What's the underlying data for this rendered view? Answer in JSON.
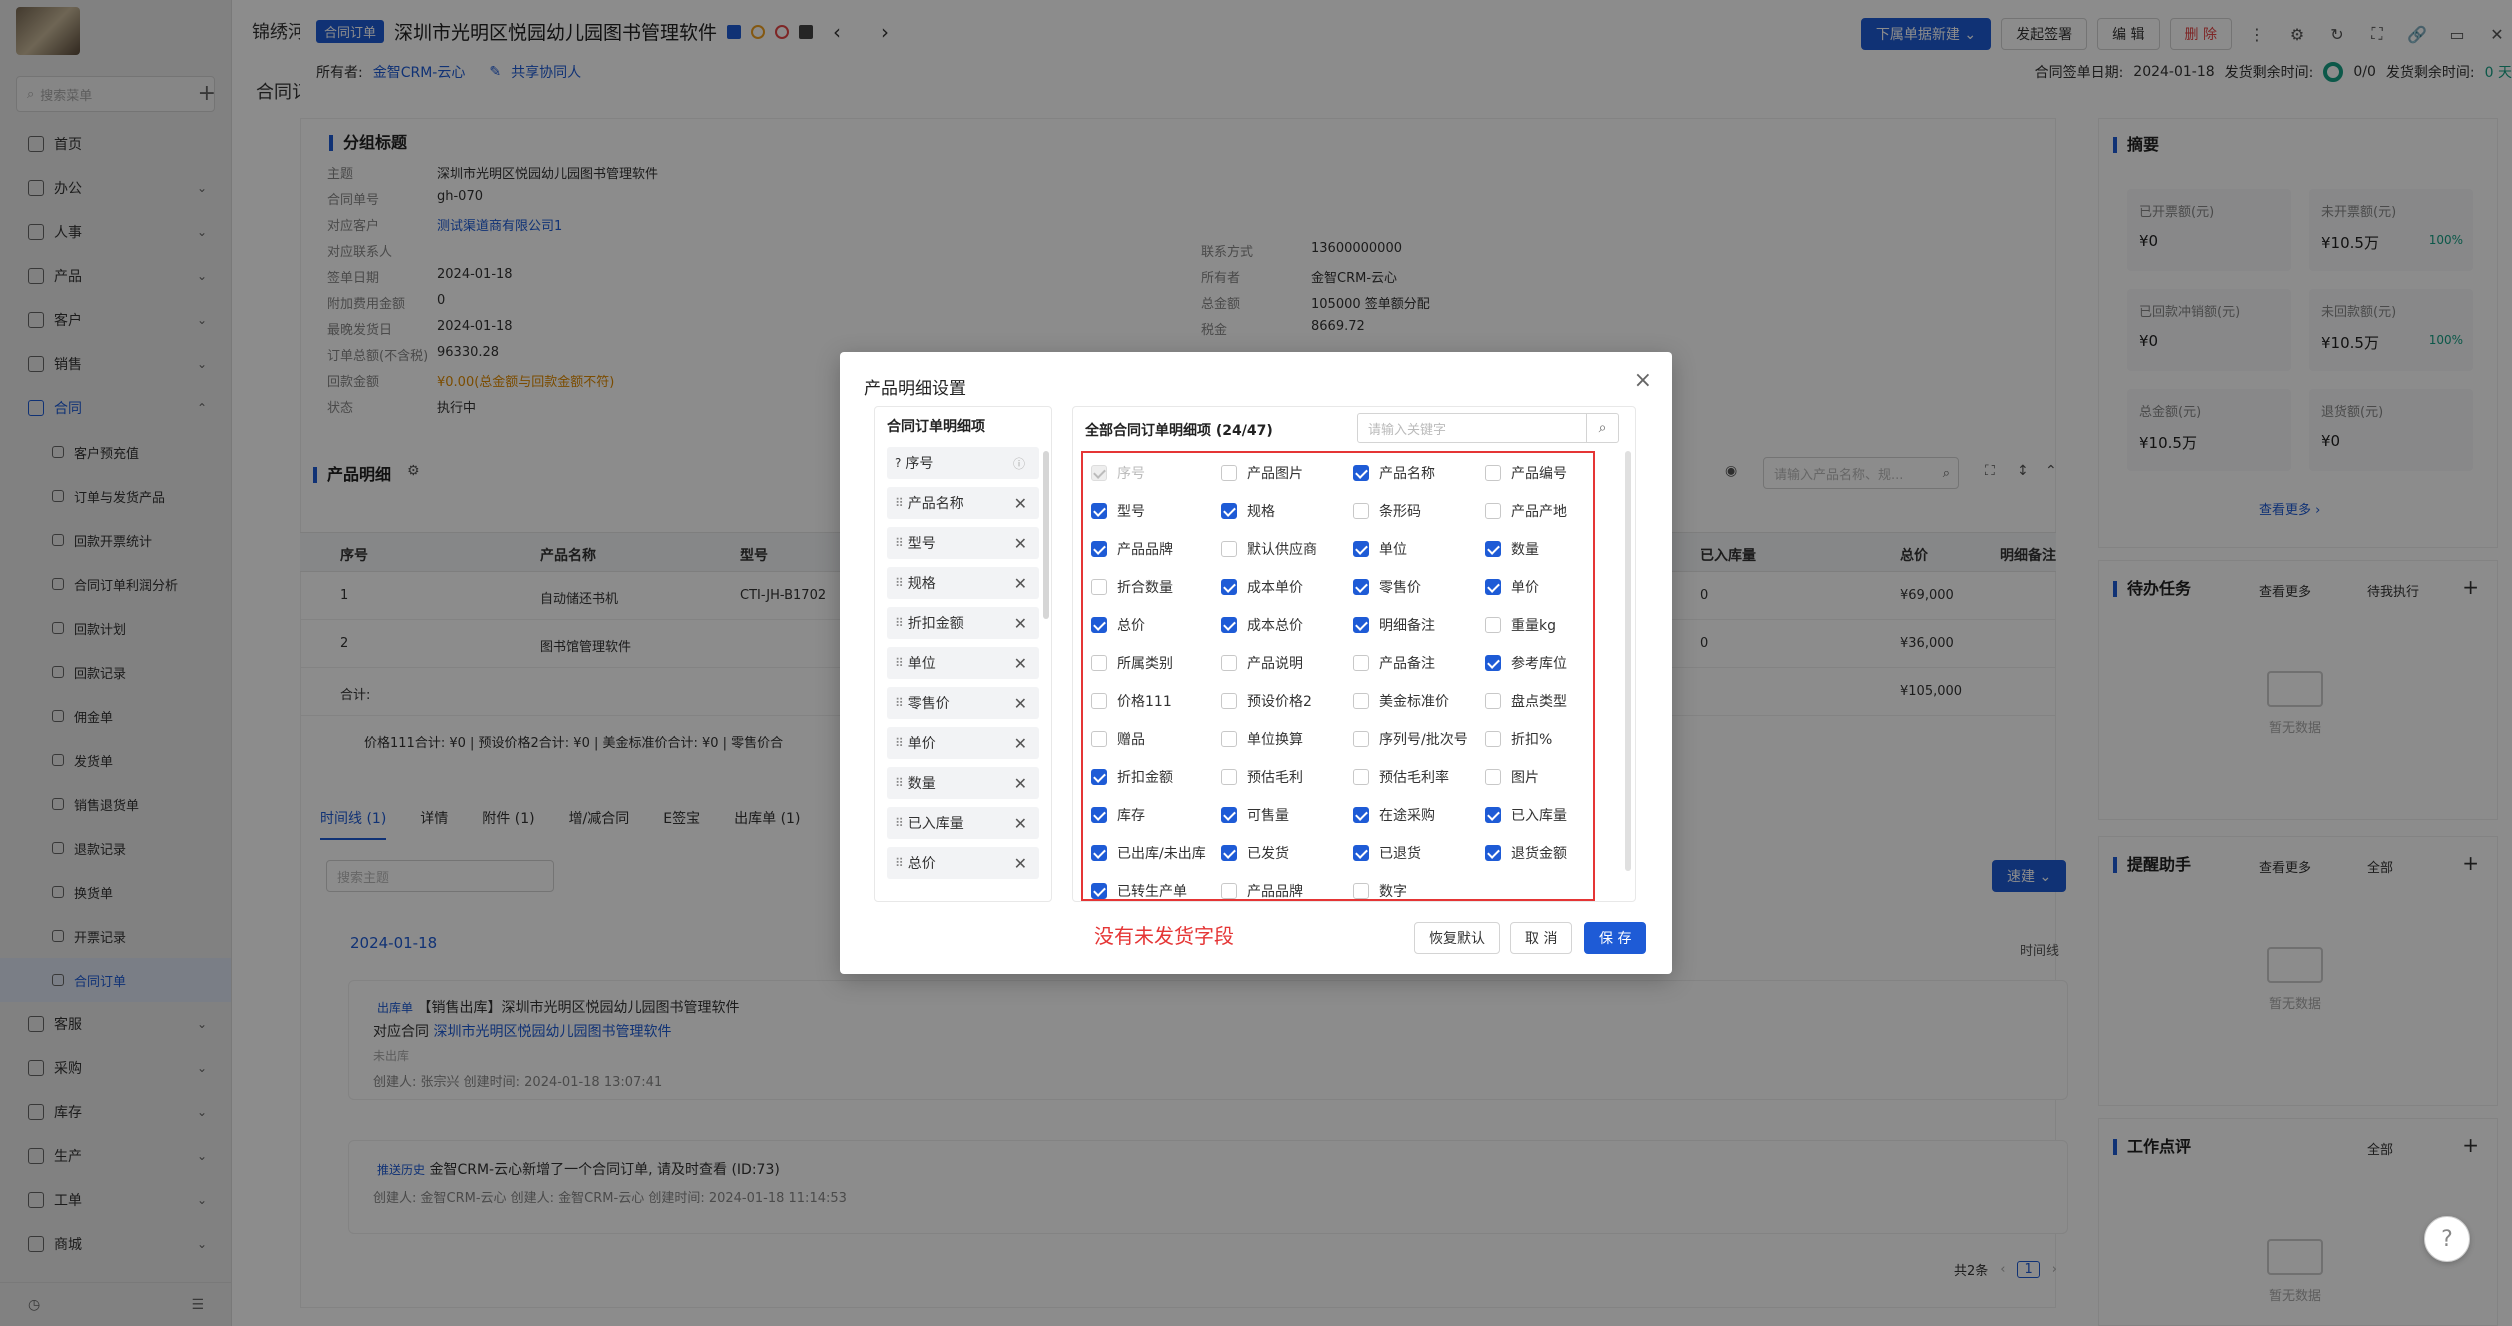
{
  "sidebar": {
    "search_placeholder": "搜索菜单",
    "items": [
      {
        "label": "首页",
        "arrow": ""
      },
      {
        "label": "办公",
        "arrow": "⌄"
      },
      {
        "label": "人事",
        "arrow": "⌄"
      },
      {
        "label": "产品",
        "arrow": "⌄"
      },
      {
        "label": "客户",
        "arrow": "⌄"
      },
      {
        "label": "销售",
        "arrow": "⌄"
      },
      {
        "label": "合同",
        "arrow": "⌃"
      }
    ],
    "sub_items": [
      "客户预充值",
      "订单与发货产品",
      "回款开票统计",
      "合同订单利润分析",
      "回款计划",
      "回款记录",
      "佣金单",
      "发货单",
      "销售退货单",
      "退款记录",
      "换货单",
      "开票记录",
      "合同订单"
    ],
    "bottom_items": [
      {
        "label": "客服",
        "arrow": "⌄"
      },
      {
        "label": "采购",
        "arrow": "⌄"
      },
      {
        "label": "库存",
        "arrow": "⌄"
      },
      {
        "label": "生产",
        "arrow": "⌄"
      },
      {
        "label": "工单",
        "arrow": "⌄"
      },
      {
        "label": "商城",
        "arrow": "⌄"
      }
    ]
  },
  "topbar": {
    "tab1": "锦绣河",
    "tab2": "合同订"
  },
  "header": {
    "badge": "合同订单",
    "title": "深圳市光明区悦园幼儿园图书管理软件",
    "owner_label": "所有者:",
    "owner_value": "金智CRM-云心",
    "collab": "共享协同人",
    "btn_new": "下属单据新建 ⌄",
    "btn_sign": "发起签署",
    "btn_edit": "编 辑",
    "btn_delete": "删 除",
    "sign_date_label": "合同签单日期:",
    "sign_date": "2024-01-18",
    "remain_label": "发货剩余时间:",
    "remain_count": "0/0",
    "remain_label2": "发货剩余时间:",
    "remain_days": "0 天"
  },
  "detail": {
    "section_title": "分组标题",
    "left": [
      {
        "k": "主题",
        "v": "深圳市光明区悦园幼儿园图书管理软件"
      },
      {
        "k": "合同单号",
        "v": "gh-070"
      },
      {
        "k": "对应客户",
        "v": "测试渠道商有限公司1"
      },
      {
        "k": "对应联系人",
        "v": ""
      },
      {
        "k": "签单日期",
        "v": "2024-01-18"
      },
      {
        "k": "附加费用金额",
        "v": "0"
      },
      {
        "k": "最晚发货日",
        "v": "2024-01-18"
      },
      {
        "k": "订单总额(不含税)",
        "v": "96330.28"
      },
      {
        "k": "回款金额",
        "v": "¥0.00(总金额与回款金额不符)"
      },
      {
        "k": "状态",
        "v": "执行中"
      }
    ],
    "right": [
      {
        "k": "联系方式",
        "v": "13600000000"
      },
      {
        "k": "所有者",
        "v": "金智CRM-云心"
      },
      {
        "k": "总金额",
        "v": "105000  签单额分配"
      },
      {
        "k": "税金",
        "v": "8669.72"
      }
    ],
    "product_title": "产品明细",
    "product_search": "请输入产品名称、规...",
    "table_headers": [
      "序号",
      "产品名称",
      "型号",
      "已入库量",
      "总价",
      "明细备注"
    ],
    "rows": [
      {
        "no": "1",
        "name": "自动储还书机",
        "model": "CTI-JH-B1702",
        "stock": "0",
        "total": "¥69,000"
      },
      {
        "no": "2",
        "name": "图书馆管理软件",
        "model": "",
        "stock": "0",
        "total": "¥36,000"
      }
    ],
    "sum_label": "合计:",
    "sum_total": "¥105,000",
    "footer_sum": "价格111合计: ¥0 | 预设价格2合计: ¥0 | 美金标准价合计: ¥0 | 零售价合",
    "tl_tabs": [
      "时间线 (1)",
      "详情",
      "附件 (1)",
      "增/减合同",
      "E签宝",
      "出库单 (1)"
    ],
    "tl_search": "搜索主题",
    "quick_new": "速建 ⌄",
    "date": "2024-01-18",
    "timeline_label": "时间线",
    "card1_tag": "出库单",
    "card1_title": "【销售出库】深圳市光明区悦园幼儿园图书管理软件",
    "card1_contract_label": "对应合同",
    "card1_contract": "深圳市光明区悦园幼儿园图书管理软件",
    "card1_status": "未出库",
    "card1_meta": "创建人: 张宗兴    创建时间: 2024-01-18 13:07:41",
    "card2_tag": "推送历史",
    "card2_title": "金智CRM-云心新增了一个合同订单, 请及时查看 (ID:73)",
    "card2_meta": "创建人: 金智CRM-云心    创建人: 金智CRM-云心    创建时间: 2024-01-18 11:14:53",
    "pager_total": "共2条",
    "pager_page": "1"
  },
  "summary": {
    "title": "摘要",
    "stats": [
      {
        "label": "已开票额(元)",
        "value": "¥0",
        "pct": ""
      },
      {
        "label": "未开票额(元)",
        "value": "¥10.5万",
        "pct": "100%"
      },
      {
        "label": "已回款冲销额(元)",
        "value": "¥0",
        "pct": ""
      },
      {
        "label": "未回款额(元)",
        "value": "¥10.5万",
        "pct": "100%"
      },
      {
        "label": "总金额(元)",
        "value": "¥10.5万",
        "pct": ""
      },
      {
        "label": "退货额(元)",
        "value": "¥0",
        "pct": ""
      }
    ],
    "more": "查看更多 ›",
    "todo_title": "待办任务",
    "todo_more": "查看更多",
    "todo_filter": "待我执行",
    "empty": "暂无数据",
    "remind_title": "提醒助手",
    "remind_more": "查看更多",
    "remind_filter": "全部",
    "review_title": "工作点评",
    "review_filter": "全部"
  },
  "modal": {
    "title": "产品明细设置",
    "left_header": "合同订单明细项",
    "left_items": [
      "序号",
      "产品名称",
      "型号",
      "规格",
      "折扣金额",
      "单位",
      "零售价",
      "单价",
      "数量",
      "已入库量",
      "总价"
    ],
    "right_header": "全部合同订单明细项 (24/47)",
    "search_placeholder": "请输入关键字",
    "options": [
      [
        "序号",
        "dis"
      ],
      [
        "产品图片",
        "off"
      ],
      [
        "产品名称",
        "on"
      ],
      [
        "产品编号",
        "off"
      ],
      [
        "型号",
        "on"
      ],
      [
        "规格",
        "on"
      ],
      [
        "条形码",
        "off"
      ],
      [
        "产品产地",
        "off"
      ],
      [
        "产品品牌",
        "on"
      ],
      [
        "默认供应商",
        "off"
      ],
      [
        "单位",
        "on"
      ],
      [
        "数量",
        "on"
      ],
      [
        "折合数量",
        "off"
      ],
      [
        "成本单价",
        "on"
      ],
      [
        "零售价",
        "on"
      ],
      [
        "单价",
        "on"
      ],
      [
        "总价",
        "on"
      ],
      [
        "成本总价",
        "on"
      ],
      [
        "明细备注",
        "on"
      ],
      [
        "重量kg",
        "off"
      ],
      [
        "所属类别",
        "off"
      ],
      [
        "产品说明",
        "off"
      ],
      [
        "产品备注",
        "off"
      ],
      [
        "参考库位",
        "on"
      ],
      [
        "价格111",
        "off"
      ],
      [
        "预设价格2",
        "off"
      ],
      [
        "美金标准价",
        "off"
      ],
      [
        "盘点类型",
        "off"
      ],
      [
        "赠品",
        "off"
      ],
      [
        "单位换算",
        "off"
      ],
      [
        "序列号/批次号",
        "off"
      ],
      [
        "折扣%",
        "off"
      ],
      [
        "折扣金额",
        "on"
      ],
      [
        "预估毛利",
        "off"
      ],
      [
        "预估毛利率",
        "off"
      ],
      [
        "图片",
        "off"
      ],
      [
        "库存",
        "on"
      ],
      [
        "可售量",
        "on"
      ],
      [
        "在途采购",
        "on"
      ],
      [
        "已入库量",
        "on"
      ],
      [
        "已出库/未出库",
        "on"
      ],
      [
        "已发货",
        "on"
      ],
      [
        "已退货",
        "on"
      ],
      [
        "退货金额",
        "on"
      ],
      [
        "已转生产单",
        "on"
      ],
      [
        "产品品牌",
        "off"
      ],
      [
        "数字",
        "off"
      ]
    ],
    "note": "没有未发货字段",
    "btn_reset": "恢复默认",
    "btn_cancel": "取 消",
    "btn_save": "保 存"
  }
}
